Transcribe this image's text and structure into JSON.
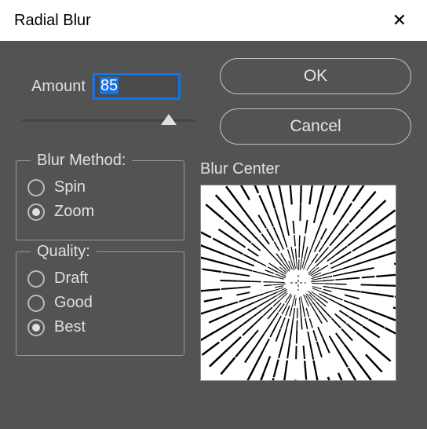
{
  "title": "Radial Blur",
  "amount": {
    "label": "Amount",
    "value": "85",
    "slider_percent": 85
  },
  "buttons": {
    "ok": "OK",
    "cancel": "Cancel"
  },
  "blur_method": {
    "legend": "Blur Method:",
    "options": [
      {
        "label": "Spin",
        "selected": false
      },
      {
        "label": "Zoom",
        "selected": true
      }
    ]
  },
  "quality": {
    "legend": "Quality:",
    "options": [
      {
        "label": "Draft",
        "selected": false
      },
      {
        "label": "Good",
        "selected": false
      },
      {
        "label": "Best",
        "selected": true
      }
    ]
  },
  "blur_center": {
    "label": "Blur Center",
    "center_x": 0.5,
    "center_y": 0.5
  }
}
